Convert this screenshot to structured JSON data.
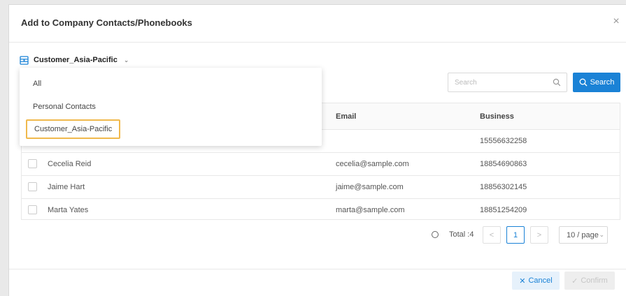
{
  "dialog": {
    "title": "Add to Company Contacts/Phonebooks",
    "close_glyph": "×"
  },
  "phonebook_selector": {
    "selected": "Customer_Asia-Pacific",
    "chevron": "⌄",
    "icon": "phonebook-icon",
    "options": [
      {
        "label": "All"
      },
      {
        "label": "Personal Contacts"
      },
      {
        "label": "Customer_Asia-Pacific",
        "selected": true
      }
    ]
  },
  "search": {
    "placeholder": "Search",
    "value": "",
    "button_label": "Search"
  },
  "table": {
    "headers": {
      "name": "",
      "email": "Email",
      "business": "Business"
    },
    "rows": [
      {
        "name": "",
        "email": "",
        "business": "15556632258"
      },
      {
        "name": "Cecelia Reid",
        "email": "cecelia@sample.com",
        "business": "18854690863"
      },
      {
        "name": "Jaime Hart",
        "email": "jaime@sample.com",
        "business": "18856302145"
      },
      {
        "name": "Marta Yates",
        "email": "marta@sample.com",
        "business": "18851254209"
      }
    ]
  },
  "pagination": {
    "total": "Total :4",
    "prev": "<",
    "current_page": "1",
    "next": ">",
    "page_size": "10 / page",
    "page_size_chevron": "⌄"
  },
  "footer": {
    "cancel_label": "Cancel",
    "cancel_glyph": "✕",
    "confirm_label": "Confirm",
    "confirm_glyph": "✓"
  },
  "colors": {
    "primary": "#1a82d6",
    "highlight_border": "#f0b94d",
    "disabled": "#c6c6c6"
  }
}
